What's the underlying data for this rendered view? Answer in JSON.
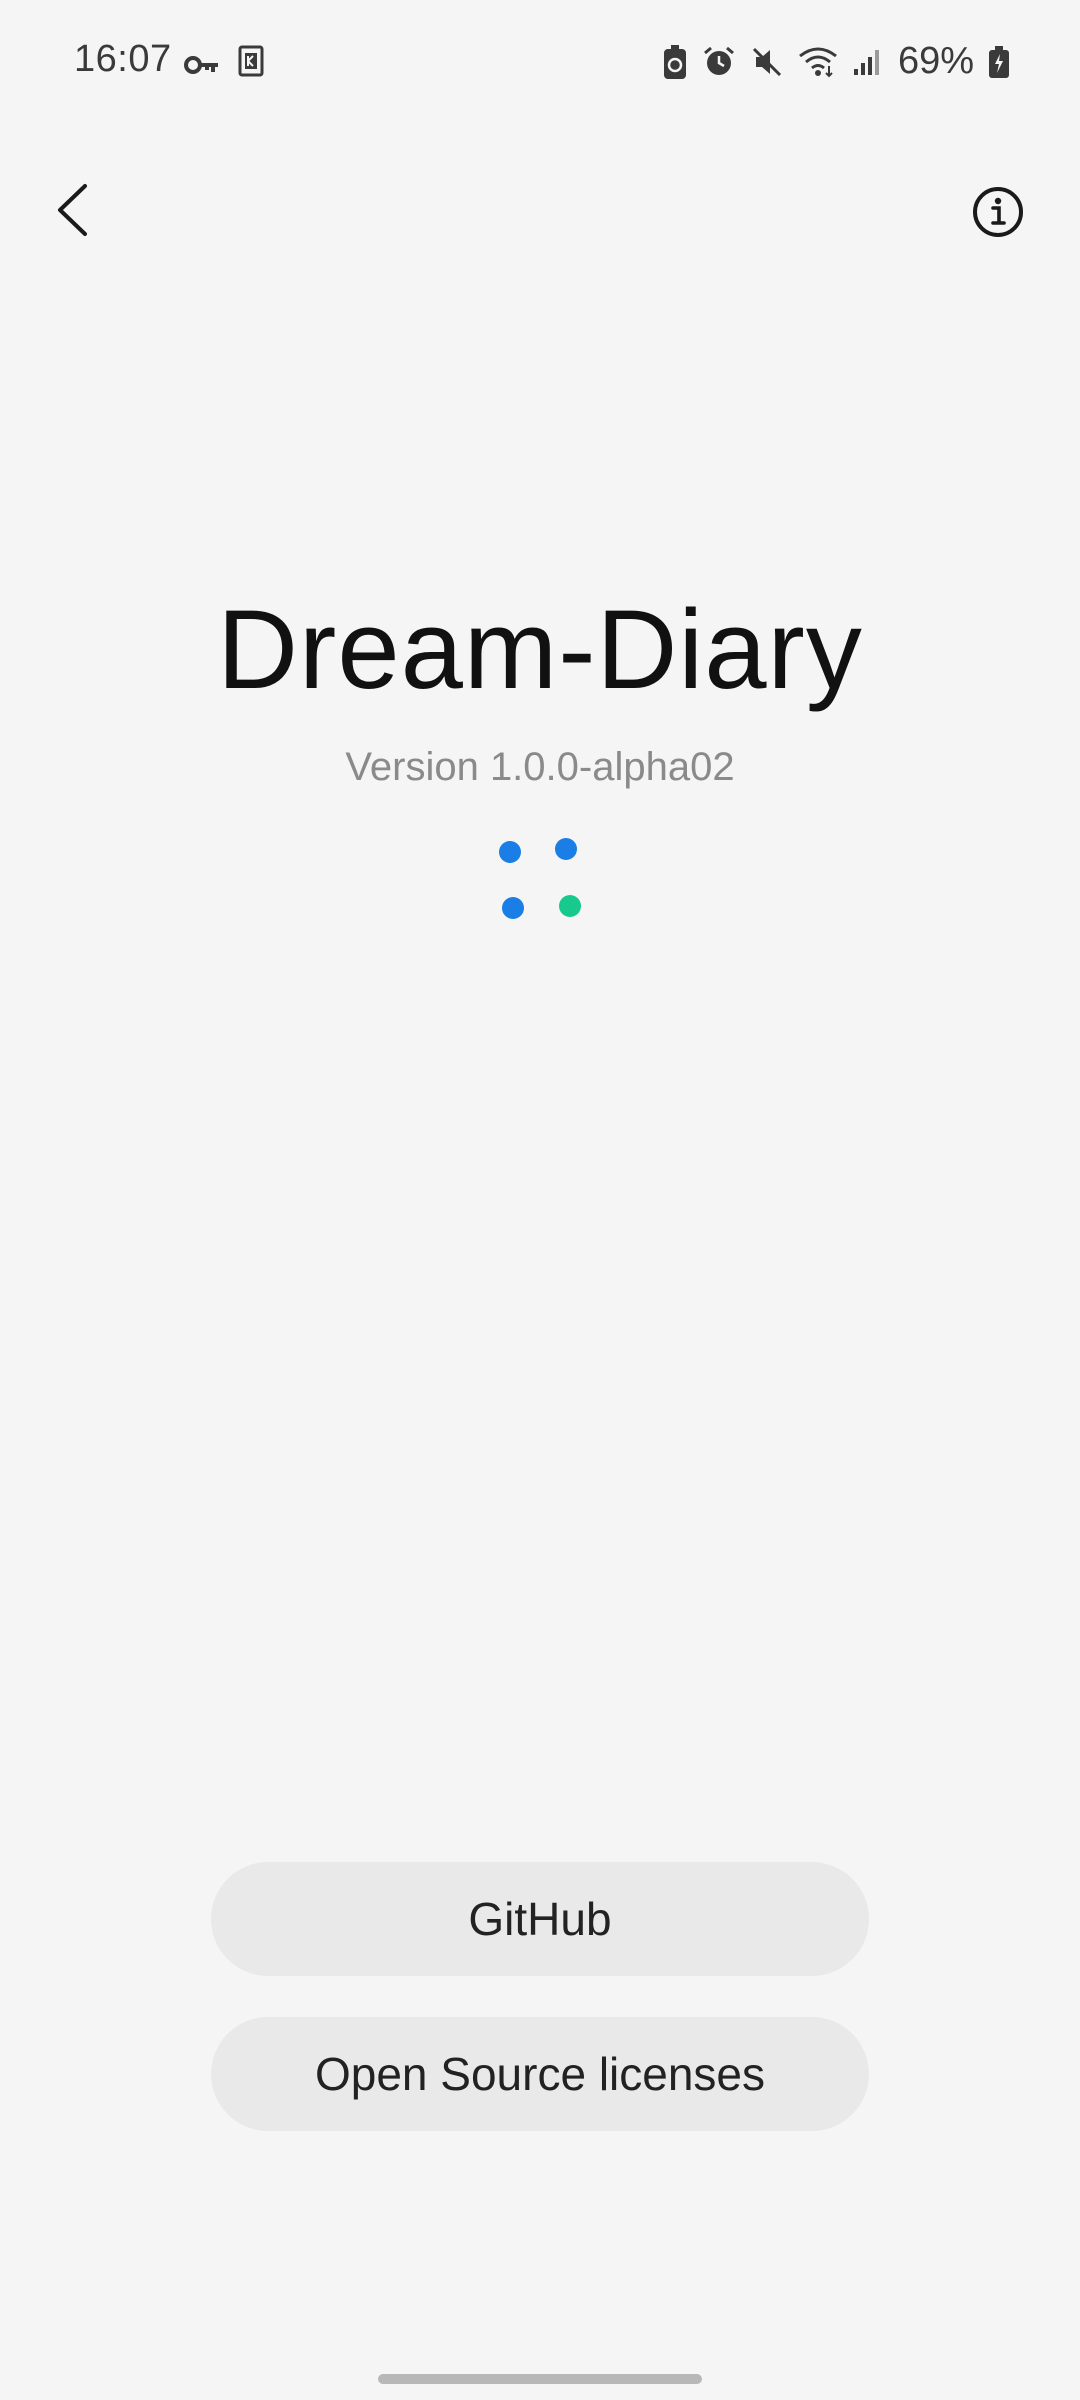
{
  "status_bar": {
    "time": "16:07",
    "battery": "69%",
    "icons": [
      "vpn-key-icon",
      "k-app-icon",
      "battery-saver-icon",
      "alarm-icon",
      "mute-icon",
      "wifi-icon",
      "signal-icon",
      "battery-icon"
    ]
  },
  "app_bar": {
    "back_icon": "chevron-left-icon",
    "info_icon": "info-icon"
  },
  "about": {
    "app_name": "Dream-Diary",
    "version": "Version 1.0.0-alpha02",
    "loading_dots_colors": [
      "#1a7ee6",
      "#1a7ee6",
      "#1a7ee6",
      "#18c98e"
    ]
  },
  "buttons": {
    "github": "GitHub",
    "licenses": "Open Source licenses"
  }
}
